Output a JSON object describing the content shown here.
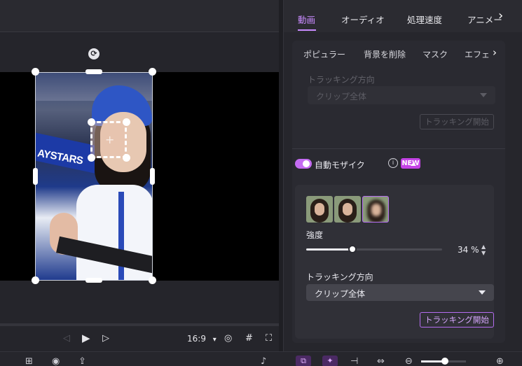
{
  "tabs": [
    {
      "label": "動画",
      "active": true
    },
    {
      "label": "オーディオ",
      "active": false
    },
    {
      "label": "処理速度",
      "active": false
    },
    {
      "label": "アニメー",
      "active": false
    }
  ],
  "subtabs": [
    "ポピュラー",
    "背景を削除",
    "マスク",
    "エフェ"
  ],
  "tracking_disabled": {
    "label": "トラッキング方向",
    "select_value": "クリップ全体",
    "button": "トラッキング開始"
  },
  "auto_mosaic": {
    "label": "自動モザイク",
    "badge": "NEW",
    "enabled": true,
    "strength_label": "強度",
    "strength_value": "34",
    "strength_unit": "%",
    "strength_fraction": 0.34,
    "tracking_label": "トラッキング方向",
    "tracking_value": "クリップ全体",
    "tracking_button": "トラッキング開始"
  },
  "player": {
    "aspect": "16:9",
    "aspect_caret": "▾"
  },
  "clip_flag_text": "AYSTARS",
  "colors": {
    "accent": "#c98bff",
    "toggle": "#c46cf2",
    "badge": "#c443e6"
  }
}
